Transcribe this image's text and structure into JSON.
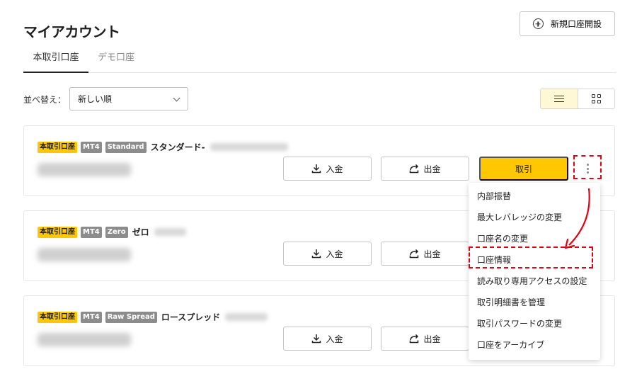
{
  "header": {
    "title": "マイアカウント",
    "new_account_label": "新規口座開設"
  },
  "tabs": [
    {
      "label": "本取引口座",
      "active": true
    },
    {
      "label": "デモ口座",
      "active": false
    }
  ],
  "sort": {
    "label": "並べ替え：",
    "selected": "新しい順"
  },
  "view": {
    "active": "list",
    "options": [
      "list-icon",
      "grid-icon"
    ]
  },
  "accounts": [
    {
      "type_badge": "本取引口座",
      "platform_badge": "MT4",
      "variant_badge": "Standard",
      "name": "スタンダード-",
      "deposit_label": "入金",
      "withdraw_label": "出金",
      "trade_label": "取引"
    },
    {
      "type_badge": "本取引口座",
      "platform_badge": "MT4",
      "variant_badge": "Zero",
      "name": "ゼロ",
      "deposit_label": "入金",
      "withdraw_label": "出金"
    },
    {
      "type_badge": "本取引口座",
      "platform_badge": "MT4",
      "variant_badge": "Raw Spread",
      "name": "ロースプレッド",
      "deposit_label": "入金",
      "withdraw_label": "出金"
    }
  ],
  "menu": {
    "items": [
      "内部振替",
      "最大レバレッジの変更",
      "口座名の変更",
      "口座情報",
      "読み取り専用アクセスの設定",
      "取引明細書を管理",
      "取引パスワードの変更",
      "口座をアーカイブ"
    ],
    "highlighted_index": 3
  },
  "colors": {
    "accent_yellow": "#ffc700",
    "annotation_red": "#e60012",
    "badge_grey": "#8c8c8c"
  }
}
